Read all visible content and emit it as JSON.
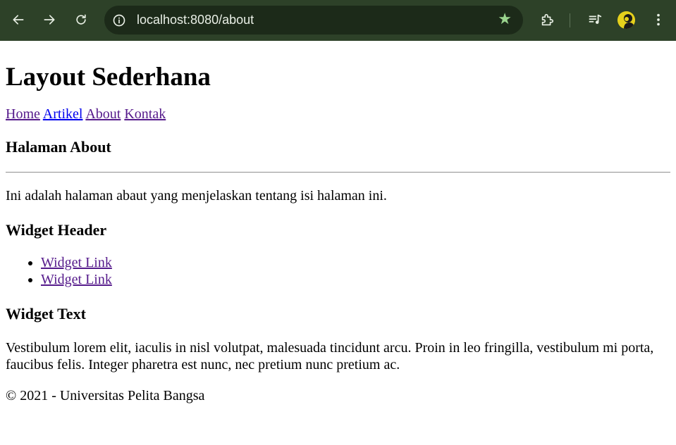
{
  "browser": {
    "url": "localhost:8080/about",
    "accent_color": "#2d4128"
  },
  "page": {
    "title": "Layout Sederhana",
    "nav": [
      {
        "label": "Home"
      },
      {
        "label": "Artikel"
      },
      {
        "label": "About"
      },
      {
        "label": "Kontak"
      }
    ],
    "section_title": "Halaman About",
    "intro": "Ini adalah halaman abaut yang menjelaskan tentang isi halaman ini.",
    "widget_header": "Widget Header",
    "widget_links": [
      {
        "label": "Widget Link"
      },
      {
        "label": "Widget Link"
      }
    ],
    "widget_text_title": "Widget Text",
    "widget_text": "Vestibulum lorem elit, iaculis in nisl volutpat, malesuada tincidunt arcu. Proin in leo fringilla, vestibulum mi porta, faucibus felis. Integer pharetra est nunc, nec pretium nunc pretium ac.",
    "footer": "© 2021 - Universitas Pelita Bangsa"
  }
}
